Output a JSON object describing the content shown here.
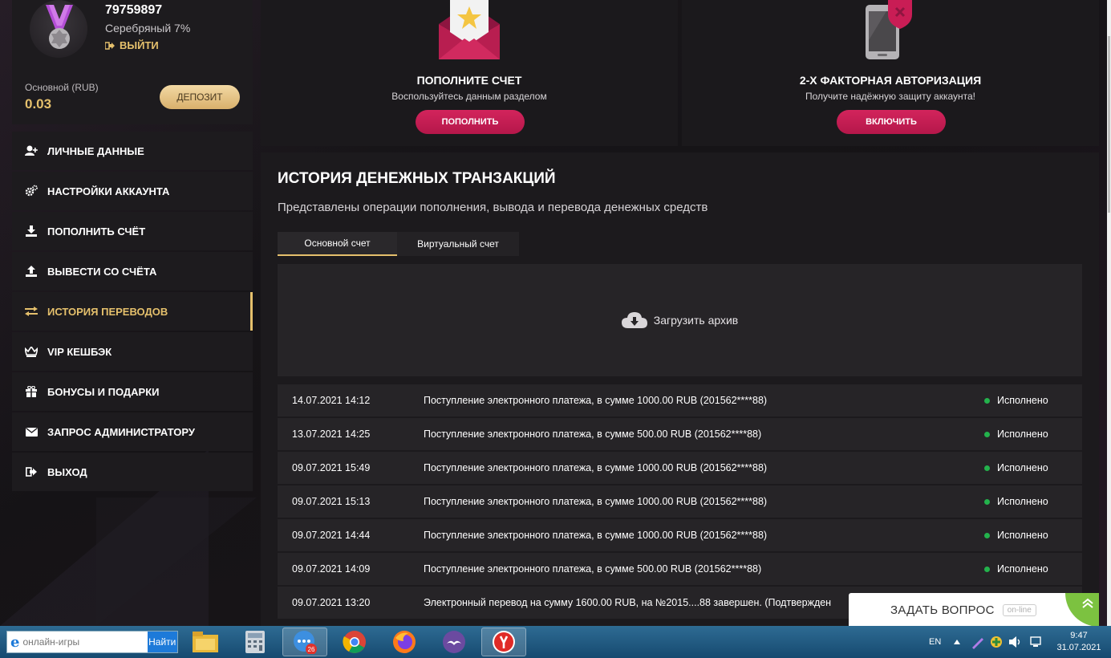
{
  "profile": {
    "user_id": "79759897",
    "level": "Серебряный 7%",
    "logout_label": "ВЫЙТИ",
    "balance_label": "Основной (RUB)",
    "balance_value": "0.03",
    "deposit_label": "ДЕПОЗИТ"
  },
  "menu": {
    "items": [
      {
        "label": "ЛИЧНЫЕ ДАННЫЕ",
        "icon": "user-plus-icon"
      },
      {
        "label": "НАСТРОЙКИ АККАУНТА",
        "icon": "gears-icon"
      },
      {
        "label": "ПОПОЛНИТЬ СЧЁТ",
        "icon": "download-icon"
      },
      {
        "label": "ВЫВЕСТИ СО СЧЁТА",
        "icon": "upload-icon"
      },
      {
        "label": "ИСТОРИЯ ПЕРЕВОДОВ",
        "icon": "exchange-icon",
        "active": true
      },
      {
        "label": "VIP КЕШБЭК",
        "icon": "crown-icon"
      },
      {
        "label": "БОНУСЫ И ПОДАРКИ",
        "icon": "gift-icon"
      },
      {
        "label": "ЗАПРОС АДМИНИСТРАТОРУ",
        "icon": "envelope-icon"
      },
      {
        "label": "ВЫХОД",
        "icon": "sign-out-icon"
      }
    ]
  },
  "cards": {
    "deposit": {
      "title": "ПОПОЛНИТЕ СЧЕТ",
      "subtitle": "Воспользуйтесь данным разделом",
      "button": "ПОПОЛНИТЬ",
      "icon": "envelope-star-icon"
    },
    "twofa": {
      "title": "2-Х ФАКТОРНАЯ АВТОРИЗАЦИЯ",
      "subtitle": "Получите надёжную защиту аккаунта!",
      "button": "ВКЛЮЧИТЬ",
      "icon": "phone-shield-icon"
    }
  },
  "main": {
    "title": "ИСТОРИЯ ДЕНЕЖНЫХ ТРАНЗАКЦИЙ",
    "subtitle": "Представлены операции пополнения, вывода и перевода денежных средств",
    "tabs": [
      {
        "label": "Основной счет",
        "active": true
      },
      {
        "label": "Виртуальный счет",
        "active": false
      }
    ],
    "archive_label": "Загрузить архив",
    "transactions": [
      {
        "date": "14.07.2021 14:12",
        "description": "Поступление электронного платежа, в сумме 1000.00 RUB (201562****88)",
        "status": "Исполнено"
      },
      {
        "date": "13.07.2021 14:25",
        "description": "Поступление электронного платежа, в сумме 500.00 RUB (201562****88)",
        "status": "Исполнено"
      },
      {
        "date": "09.07.2021 15:49",
        "description": "Поступление электронного платежа, в сумме 1000.00 RUB (201562****88)",
        "status": "Исполнено"
      },
      {
        "date": "09.07.2021 15:13",
        "description": "Поступление электронного платежа, в сумме 1000.00 RUB (201562****88)",
        "status": "Исполнено"
      },
      {
        "date": "09.07.2021 14:44",
        "description": "Поступление электронного платежа, в сумме 1000.00 RUB (201562****88)",
        "status": "Исполнено"
      },
      {
        "date": "09.07.2021 14:09",
        "description": "Поступление электронного платежа, в сумме 500.00 RUB (201562****88)",
        "status": "Исполнено"
      },
      {
        "date": "09.07.2021 13:20",
        "description": "Электронный перевод на сумму 1600.00 RUB, на №2015....88 завершен. (Подтвержден",
        "status": ""
      }
    ]
  },
  "chat": {
    "label": "ЗАДАТЬ ВОПРОС",
    "status": "on-line"
  },
  "taskbar": {
    "search_placeholder": "онлайн-игры",
    "search_button": "Найти",
    "mail_badge": "26",
    "language": "EN",
    "time": "9:47",
    "date": "31.07.2021"
  },
  "colors": {
    "accent_gold": "#e5c06c",
    "accent_pink": "#c91d55",
    "status_green": "#23b24c"
  }
}
